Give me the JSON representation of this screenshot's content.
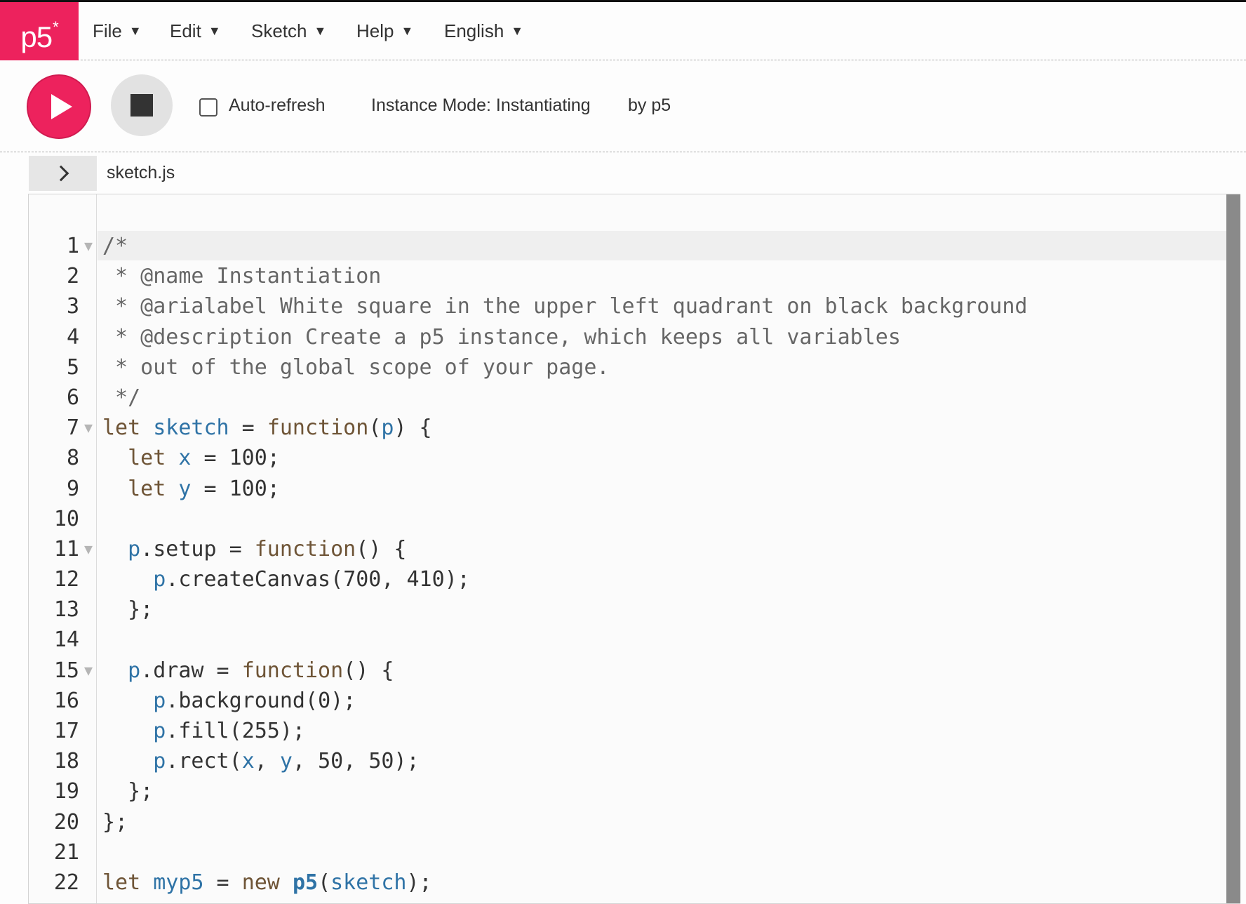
{
  "colors": {
    "brand": "#ed225d",
    "comment": "#666666",
    "keyword": "#6e5436",
    "variable": "#2f73a6"
  },
  "logo": {
    "text": "p5",
    "mark": "*"
  },
  "menu": {
    "items": [
      {
        "label": "File"
      },
      {
        "label": "Edit"
      },
      {
        "label": "Sketch"
      },
      {
        "label": "Help"
      },
      {
        "label": "English"
      }
    ]
  },
  "toolbar": {
    "play_icon": "play-icon",
    "stop_icon": "stop-icon",
    "auto_refresh_label": "Auto-refresh",
    "auto_refresh_checked": false,
    "sketch_title": "Instance Mode: Instantiating",
    "author": "by p5"
  },
  "editor": {
    "file_name": "sketch.js",
    "lines": [
      {
        "n": "1",
        "fold": true,
        "tokens": [
          [
            "c-comment",
            "/*"
          ]
        ]
      },
      {
        "n": "2",
        "fold": false,
        "tokens": [
          [
            "c-comment",
            " * @name Instantiation"
          ]
        ]
      },
      {
        "n": "3",
        "fold": false,
        "tokens": [
          [
            "c-comment",
            " * @arialabel White square in the upper left quadrant on black background"
          ]
        ]
      },
      {
        "n": "4",
        "fold": false,
        "tokens": [
          [
            "c-comment",
            " * @description Create a p5 instance, which keeps all variables"
          ]
        ]
      },
      {
        "n": "5",
        "fold": false,
        "tokens": [
          [
            "c-comment",
            " * out of the global scope of your page."
          ]
        ]
      },
      {
        "n": "6",
        "fold": false,
        "tokens": [
          [
            "c-comment",
            " */"
          ]
        ]
      },
      {
        "n": "7",
        "fold": true,
        "tokens": [
          [
            "c-kw",
            "let "
          ],
          [
            "c-def",
            "sketch"
          ],
          [
            "",
            " = "
          ],
          [
            "c-kw",
            "function"
          ],
          [
            "",
            "("
          ],
          [
            "c-def",
            "p"
          ],
          [
            "",
            ") {"
          ]
        ]
      },
      {
        "n": "8",
        "fold": false,
        "tokens": [
          [
            "",
            "  "
          ],
          [
            "c-kw",
            "let "
          ],
          [
            "c-def",
            "x"
          ],
          [
            "",
            " = "
          ],
          [
            "c-num",
            "100"
          ],
          [
            "",
            ";"
          ]
        ]
      },
      {
        "n": "9",
        "fold": false,
        "tokens": [
          [
            "",
            "  "
          ],
          [
            "c-kw",
            "let "
          ],
          [
            "c-def",
            "y"
          ],
          [
            "",
            " = "
          ],
          [
            "c-num",
            "100"
          ],
          [
            "",
            ";"
          ]
        ]
      },
      {
        "n": "10",
        "fold": false,
        "tokens": []
      },
      {
        "n": "11",
        "fold": true,
        "tokens": [
          [
            "",
            "  "
          ],
          [
            "c-var",
            "p"
          ],
          [
            "",
            ".setup = "
          ],
          [
            "c-kw",
            "function"
          ],
          [
            "",
            "() {"
          ]
        ]
      },
      {
        "n": "12",
        "fold": false,
        "tokens": [
          [
            "",
            "    "
          ],
          [
            "c-var",
            "p"
          ],
          [
            "",
            ".createCanvas("
          ],
          [
            "c-num",
            "700"
          ],
          [
            "",
            ", "
          ],
          [
            "c-num",
            "410"
          ],
          [
            "",
            ");"
          ]
        ]
      },
      {
        "n": "13",
        "fold": false,
        "tokens": [
          [
            "",
            "  };"
          ]
        ]
      },
      {
        "n": "14",
        "fold": false,
        "tokens": []
      },
      {
        "n": "15",
        "fold": true,
        "tokens": [
          [
            "",
            "  "
          ],
          [
            "c-var",
            "p"
          ],
          [
            "",
            ".draw = "
          ],
          [
            "c-kw",
            "function"
          ],
          [
            "",
            "() {"
          ]
        ]
      },
      {
        "n": "16",
        "fold": false,
        "tokens": [
          [
            "",
            "    "
          ],
          [
            "c-var",
            "p"
          ],
          [
            "",
            ".background("
          ],
          [
            "c-num",
            "0"
          ],
          [
            "",
            ");"
          ]
        ]
      },
      {
        "n": "17",
        "fold": false,
        "tokens": [
          [
            "",
            "    "
          ],
          [
            "c-var",
            "p"
          ],
          [
            "",
            ".fill("
          ],
          [
            "c-num",
            "255"
          ],
          [
            "",
            ");"
          ]
        ]
      },
      {
        "n": "18",
        "fold": false,
        "tokens": [
          [
            "",
            "    "
          ],
          [
            "c-var",
            "p"
          ],
          [
            "",
            ".rect("
          ],
          [
            "c-var",
            "x"
          ],
          [
            "",
            ", "
          ],
          [
            "c-var",
            "y"
          ],
          [
            "",
            ", "
          ],
          [
            "c-num",
            "50"
          ],
          [
            "",
            ", "
          ],
          [
            "c-num",
            "50"
          ],
          [
            "",
            ");"
          ]
        ]
      },
      {
        "n": "19",
        "fold": false,
        "tokens": [
          [
            "",
            "  };"
          ]
        ]
      },
      {
        "n": "20",
        "fold": false,
        "tokens": [
          [
            "",
            "};"
          ]
        ]
      },
      {
        "n": "21",
        "fold": false,
        "tokens": []
      },
      {
        "n": "22",
        "fold": false,
        "tokens": [
          [
            "c-kw",
            "let "
          ],
          [
            "c-def",
            "myp5"
          ],
          [
            "",
            " = "
          ],
          [
            "c-kw",
            "new "
          ],
          [
            "c-bold",
            "p5"
          ],
          [
            "",
            "("
          ],
          [
            "c-var",
            "sketch"
          ],
          [
            "",
            ");"
          ]
        ]
      }
    ]
  }
}
